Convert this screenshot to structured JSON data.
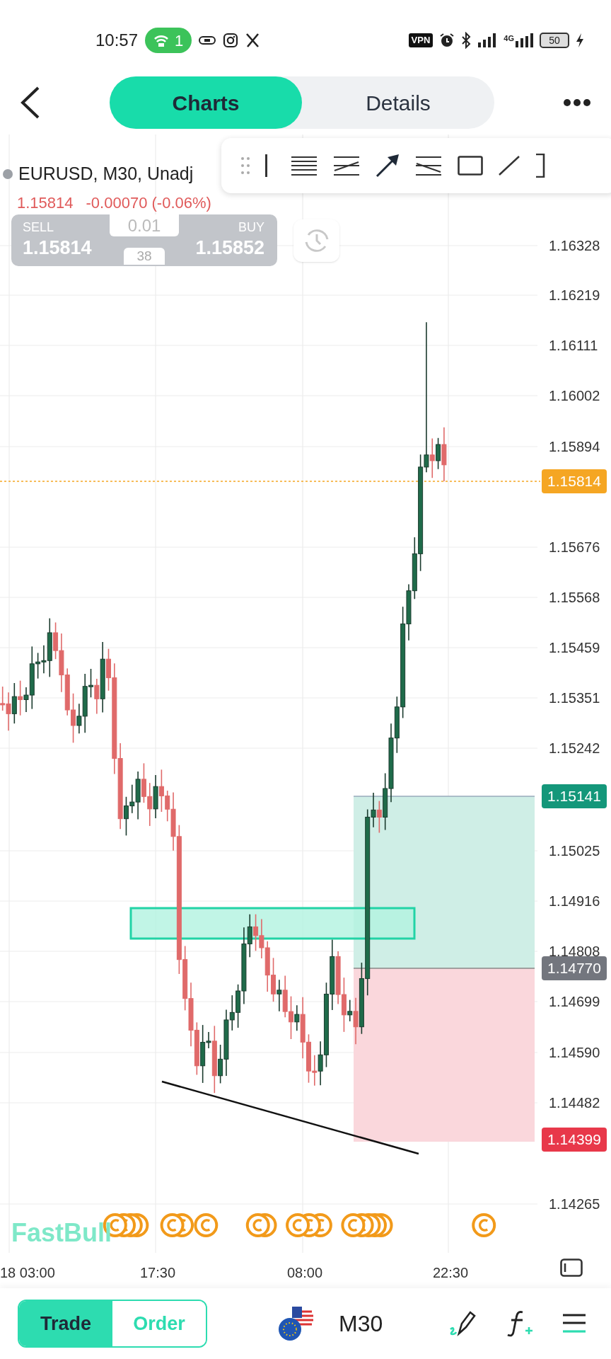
{
  "status_bar": {
    "time": "10:57",
    "hotspot_count": "1",
    "vpn": "VPN",
    "network": "4G",
    "battery": "50"
  },
  "tabs": [
    {
      "label": "Charts",
      "selected": true
    },
    {
      "label": "Details",
      "selected": false
    }
  ],
  "symbol": {
    "title": "EURUSD, M30, Unadj",
    "price": "1.15814",
    "change": "-0.00070 (-0.06%)"
  },
  "trade_widget": {
    "sell_label": "SELL",
    "sell_price": "1.15814",
    "lot": "0.01",
    "spread": "38",
    "buy_label": "BUY",
    "buy_price": "1.15852"
  },
  "price_axis": [
    "1.16328",
    "1.16219",
    "1.16111",
    "1.16002",
    "1.15894",
    "1.15676",
    "1.15568",
    "1.15459",
    "1.15351",
    "1.15242",
    "1.15025",
    "1.14916",
    "1.14808",
    "1.14699",
    "1.14590",
    "1.14482",
    "1.14265"
  ],
  "price_badges": [
    {
      "text": "1.15814",
      "color": "#f5a623"
    },
    {
      "text": "1.15141",
      "color": "#14977a"
    },
    {
      "text": "1.14770",
      "color": "#73767e"
    },
    {
      "text": "1.14399",
      "color": "#e8384a"
    }
  ],
  "time_axis": [
    "18 03:00",
    "17:30",
    "08:00",
    "22:30"
  ],
  "watermark": "FastBull",
  "bottom_bar": {
    "toggle": [
      {
        "label": "Trade",
        "selected": true
      },
      {
        "label": "Order",
        "selected": false
      }
    ],
    "timeframe": "M30"
  }
}
